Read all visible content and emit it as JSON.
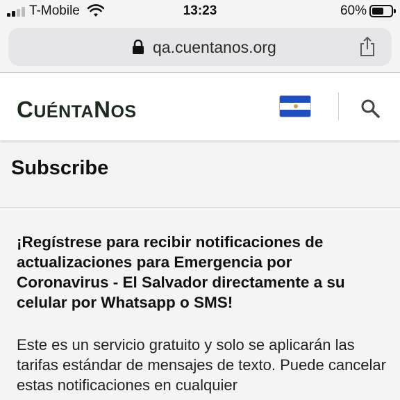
{
  "status_bar": {
    "carrier": "T-Mobile",
    "time": "13:23",
    "battery": "60%",
    "battery_level": 0.6,
    "signal_bars": 2
  },
  "browser": {
    "url": "qa.cuentanos.org",
    "icons": [
      "lock-icon",
      "share-icon"
    ]
  },
  "header": {
    "logo_text": "CUÉNTANOS",
    "logo_parts": [
      "C",
      "UÉNTA",
      "N",
      "OS"
    ],
    "flag": "El Salvador",
    "icons": [
      "el-salvador-flag-icon",
      "search-icon"
    ]
  },
  "page": {
    "title": "Subscribe",
    "headline": "¡Regístrese para recibir notificaciones de actualizaciones para Emergencia por Coronavirus - El Salvador directamente a su celular por Whatsapp o SMS!",
    "body": "Este es un servicio gratuito y solo se aplicarán las tarifas estándar de mensajes de texto. Puede cancelar estas notificaciones en cualquier"
  },
  "colors": {
    "logo": "#1e2a1e",
    "flag_blue": "#1e4fc2",
    "url_bar": "#e6e6e8",
    "page_bg": "#f4f4f4"
  }
}
